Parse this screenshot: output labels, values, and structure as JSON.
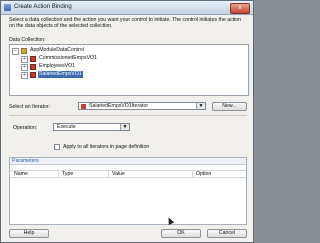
{
  "window": {
    "title": "Create Action Binding",
    "close_label": "x"
  },
  "description": "Select a data collection and the action you want your control to initiate. The control initiates the action on the data objects of the selected collection.",
  "data_collection": {
    "label": "Data Collection:",
    "root": "AppModuleDataControl",
    "items": [
      {
        "label": "CommissionedEmpsVO1",
        "selected": false
      },
      {
        "label": "EmployeesVO1",
        "selected": false
      },
      {
        "label": "SalariedEmpsVO1",
        "selected": true
      }
    ]
  },
  "iterator": {
    "label": "Select an Iterator:",
    "value": "SalariedEmpsVO1Iterator",
    "new_button": "New..."
  },
  "operation": {
    "label": "Operation:",
    "value": "Execute"
  },
  "apply_all": {
    "label": "Apply to all iterators in page definition",
    "checked": false
  },
  "parameters": {
    "title": "Parameters",
    "columns": [
      "Name",
      "Type",
      "Value",
      "Option"
    ]
  },
  "footer": {
    "help": "Help",
    "ok": "OK",
    "cancel": "Cancel"
  }
}
